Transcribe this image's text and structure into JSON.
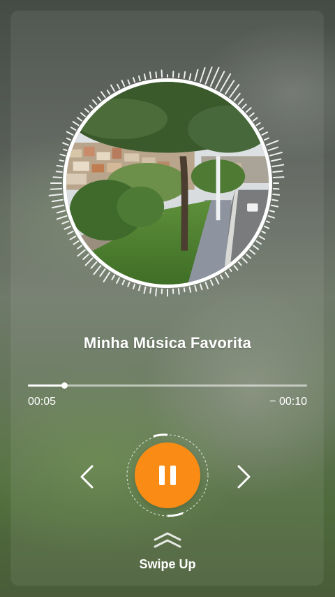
{
  "song": {
    "title": "Minha Música Favorita",
    "elapsed": "00:05",
    "remaining": "− 00:10",
    "progress": 0.13
  },
  "controls": {
    "prev_icon": "chevron-left-icon",
    "play_state_icon": "pause-icon",
    "next_icon": "chevron-right-icon",
    "accent": "#fa8c16"
  },
  "swipe": {
    "label": "Swipe Up",
    "icon": "double-chevron-up-icon"
  },
  "artwork": {
    "icon": "album-art-street-photo"
  }
}
